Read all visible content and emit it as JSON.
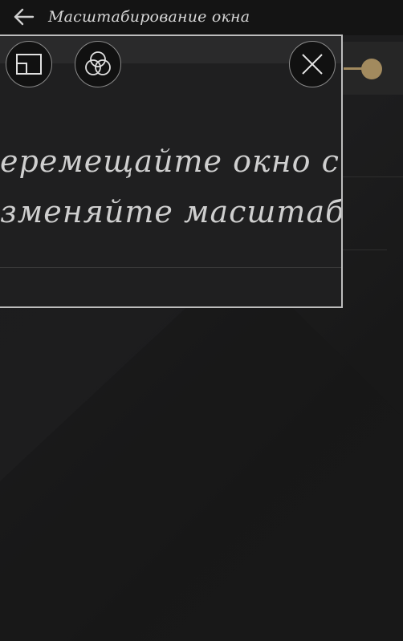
{
  "header": {
    "title": "Масштабирование окна",
    "back_icon": "arrow-left-icon"
  },
  "magnifier": {
    "line1": "еремещайте окно с по",
    "line2": "зменяйте масштаб дв",
    "toolbar": {
      "resize_icon": "window-resize-icon",
      "filter_icon": "color-filter-icon",
      "close_icon": "close-icon"
    }
  },
  "colors": {
    "accent": "#a28a5e",
    "frame": "#bdbdbd",
    "background": "#1a1a1a"
  }
}
